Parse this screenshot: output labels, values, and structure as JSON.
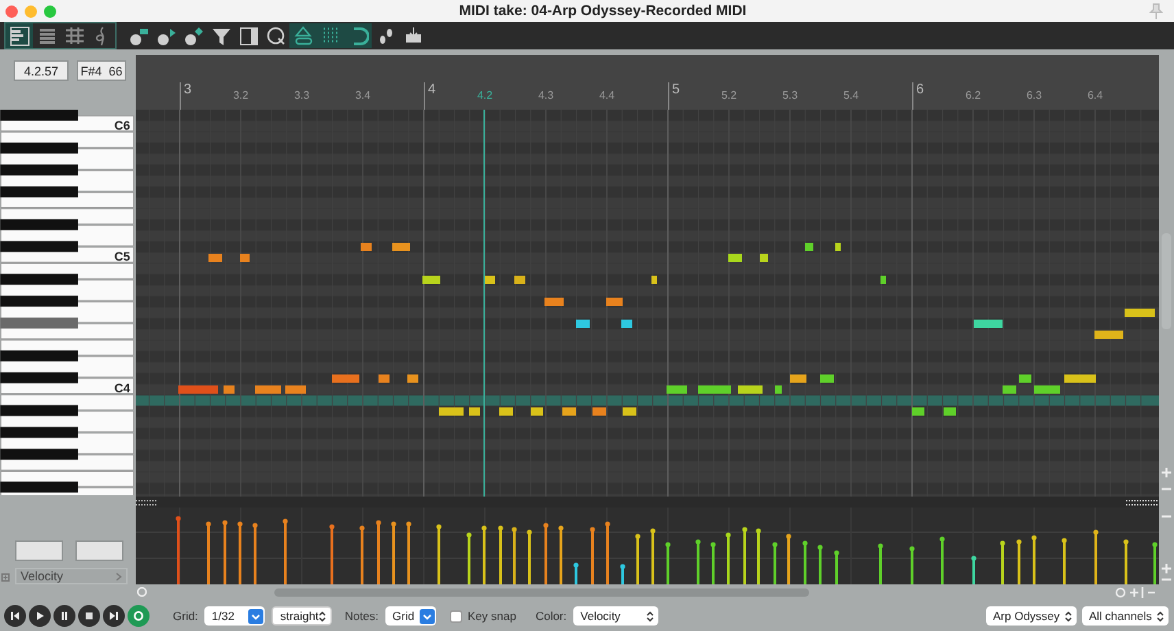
{
  "window": {
    "title": "MIDI take: 04-Arp Odyssey-Recorded MIDI"
  },
  "toolbar": [
    {
      "kind": "piano-roll",
      "on": true
    },
    {
      "kind": "named-notes",
      "on": false
    },
    {
      "kind": "event-list",
      "on": false
    },
    {
      "kind": "notation",
      "on": false
    },
    {
      "kind": "insert-note",
      "on": false
    },
    {
      "kind": "insert-play",
      "on": false
    },
    {
      "kind": "insert-diamond",
      "on": false
    },
    {
      "kind": "filter",
      "on": false
    },
    {
      "kind": "panel",
      "on": false
    },
    {
      "kind": "quantize",
      "on": false
    },
    {
      "kind": "link",
      "on": true
    },
    {
      "kind": "grid",
      "on": true
    },
    {
      "kind": "magnet",
      "on": true
    },
    {
      "kind": "steps",
      "on": false
    },
    {
      "kind": "tray",
      "on": false
    }
  ],
  "position": {
    "time": "4.2.57",
    "note": "F#4  66"
  },
  "ruler": [
    {
      "label": "3",
      "kind": "bar",
      "selected": false
    },
    {
      "label": "3.2",
      "kind": "beat",
      "selected": false
    },
    {
      "label": "3.3",
      "kind": "beat",
      "selected": false
    },
    {
      "label": "3.4",
      "kind": "beat",
      "selected": false
    },
    {
      "label": "4",
      "kind": "bar",
      "selected": false
    },
    {
      "label": "4.2",
      "kind": "beat",
      "selected": true
    },
    {
      "label": "4.3",
      "kind": "beat",
      "selected": false
    },
    {
      "label": "4.4",
      "kind": "beat",
      "selected": false
    },
    {
      "label": "5",
      "kind": "bar",
      "selected": false
    },
    {
      "label": "5.2",
      "kind": "beat",
      "selected": false
    },
    {
      "label": "5.3",
      "kind": "beat",
      "selected": false
    },
    {
      "label": "5.4",
      "kind": "beat",
      "selected": false
    },
    {
      "label": "6",
      "kind": "bar",
      "selected": false
    },
    {
      "label": "6.2",
      "kind": "beat",
      "selected": false
    },
    {
      "label": "6.3",
      "kind": "beat",
      "selected": false
    },
    {
      "label": "6.4",
      "kind": "beat",
      "selected": false
    }
  ],
  "keyboard": {
    "octave_labels": [
      "C6",
      "C5",
      "C4"
    ],
    "keys": [
      {
        "kind": "black",
        "selected": false,
        "highlighted": false
      },
      {
        "kind": "white",
        "selected": false,
        "highlighted": false
      },
      {
        "kind": "white",
        "selected": false,
        "highlighted": false
      },
      {
        "kind": "black",
        "selected": false,
        "highlighted": false
      },
      {
        "kind": "white",
        "selected": false,
        "highlighted": false
      },
      {
        "kind": "black",
        "selected": false,
        "highlighted": false
      },
      {
        "kind": "white",
        "selected": false,
        "highlighted": false
      },
      {
        "kind": "black",
        "selected": false,
        "highlighted": false
      },
      {
        "kind": "white",
        "selected": false,
        "highlighted": false
      },
      {
        "kind": "white",
        "selected": false,
        "highlighted": false
      },
      {
        "kind": "black",
        "selected": false,
        "highlighted": false
      },
      {
        "kind": "white",
        "selected": false,
        "highlighted": false
      },
      {
        "kind": "black",
        "selected": false,
        "highlighted": false
      },
      {
        "kind": "white",
        "selected": false,
        "highlighted": false
      },
      {
        "kind": "white",
        "selected": false,
        "highlighted": false
      },
      {
        "kind": "black",
        "selected": false,
        "highlighted": false
      },
      {
        "kind": "white",
        "selected": false,
        "highlighted": false
      },
      {
        "kind": "black",
        "selected": false,
        "highlighted": false
      },
      {
        "kind": "white",
        "selected": false,
        "highlighted": false
      },
      {
        "kind": "black",
        "selected": true,
        "highlighted": false
      },
      {
        "kind": "white",
        "selected": false,
        "highlighted": false
      },
      {
        "kind": "white",
        "selected": false,
        "highlighted": false
      },
      {
        "kind": "black",
        "selected": false,
        "highlighted": false
      },
      {
        "kind": "white",
        "selected": false,
        "highlighted": false
      },
      {
        "kind": "black",
        "selected": false,
        "highlighted": false
      },
      {
        "kind": "white",
        "selected": false,
        "highlighted": false
      },
      {
        "kind": "white",
        "selected": false,
        "highlighted": true
      },
      {
        "kind": "black",
        "selected": false,
        "highlighted": false
      },
      {
        "kind": "white",
        "selected": false,
        "highlighted": false
      },
      {
        "kind": "black",
        "selected": false,
        "highlighted": false
      },
      {
        "kind": "white",
        "selected": false,
        "highlighted": false
      },
      {
        "kind": "black",
        "selected": false,
        "highlighted": false
      },
      {
        "kind": "white",
        "selected": false,
        "highlighted": false
      },
      {
        "kind": "white",
        "selected": false,
        "highlighted": false
      },
      {
        "kind": "black",
        "selected": false,
        "highlighted": false
      },
      {
        "kind": "white",
        "selected": false,
        "highlighted": false
      }
    ]
  },
  "lane": {
    "type": "Velocity"
  },
  "transport": [
    {
      "kind": "skip-back"
    },
    {
      "kind": "play"
    },
    {
      "kind": "pause"
    },
    {
      "kind": "stop"
    },
    {
      "kind": "skip-forward"
    },
    {
      "kind": "repeat"
    }
  ],
  "bottom_bar": {
    "grid_label": "Grid:",
    "grid": "1/32",
    "swing": "straight",
    "notes_label": "Notes:",
    "notes": "Grid",
    "key_snap": {
      "label": "Key snap",
      "checked": false
    },
    "color_label": "Color:",
    "color_mode": "Velocity",
    "instrument": "Arp Odyssey",
    "channels": "All channels"
  }
}
